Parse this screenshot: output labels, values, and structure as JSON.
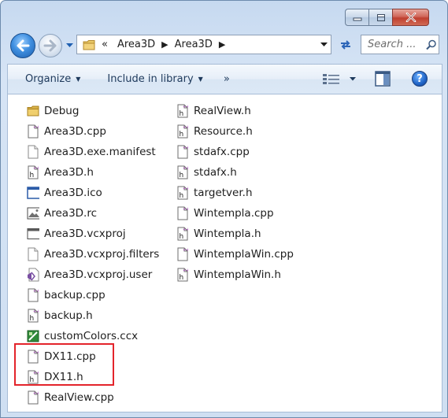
{
  "window": {
    "caption_buttons": [
      "minimize",
      "maximize",
      "close"
    ]
  },
  "navigation": {
    "back_icon": "back-arrow-icon",
    "forward_icon": "forward-arrow-icon",
    "history_dropdown_icon": "chevron-down-icon"
  },
  "address_bar": {
    "overflow": "«",
    "crumbs": [
      "Area3D",
      "Area3D"
    ],
    "separator": "▶"
  },
  "search": {
    "placeholder": "Search ..."
  },
  "toolbar": {
    "organize_label": "Organize",
    "include_label": "Include in library",
    "more_label": "»",
    "help_label": "?"
  },
  "files": {
    "column1": [
      {
        "name": "Debug",
        "icon": "folder-icon"
      },
      {
        "name": "Area3D.cpp",
        "icon": "cpp-file-icon"
      },
      {
        "name": "Area3D.exe.manifest",
        "icon": "generic-file-icon"
      },
      {
        "name": "Area3D.h",
        "icon": "header-file-icon"
      },
      {
        "name": "Area3D.ico",
        "icon": "ico-file-icon"
      },
      {
        "name": "Area3D.rc",
        "icon": "image-file-icon"
      },
      {
        "name": "Area3D.vcxproj",
        "icon": "window-file-icon"
      },
      {
        "name": "Area3D.vcxproj.filters",
        "icon": "generic-file-icon"
      },
      {
        "name": "Area3D.vcxproj.user",
        "icon": "vs-user-file-icon"
      },
      {
        "name": "backup.cpp",
        "icon": "cpp-file-icon"
      },
      {
        "name": "backup.h",
        "icon": "header-file-icon"
      },
      {
        "name": "customColors.ccx",
        "icon": "ccx-file-icon"
      },
      {
        "name": "DX11.cpp",
        "icon": "cpp-file-icon"
      },
      {
        "name": "DX11.h",
        "icon": "header-file-icon"
      },
      {
        "name": "RealView.cpp",
        "icon": "cpp-file-icon"
      }
    ],
    "column2": [
      {
        "name": "RealView.h",
        "icon": "header-file-icon"
      },
      {
        "name": "Resource.h",
        "icon": "header-file-icon"
      },
      {
        "name": "stdafx.cpp",
        "icon": "cpp-file-icon"
      },
      {
        "name": "stdafx.h",
        "icon": "header-file-icon"
      },
      {
        "name": "targetver.h",
        "icon": "header-file-icon"
      },
      {
        "name": "Wintempla.cpp",
        "icon": "cpp-file-icon"
      },
      {
        "name": "Wintempla.h",
        "icon": "header-file-icon"
      },
      {
        "name": "WintemplaWin.cpp",
        "icon": "cpp-file-icon"
      },
      {
        "name": "WintemplaWin.h",
        "icon": "header-file-icon"
      }
    ]
  },
  "colors": {
    "highlight_border": "#e3242b",
    "command_text": "#1e395b"
  }
}
